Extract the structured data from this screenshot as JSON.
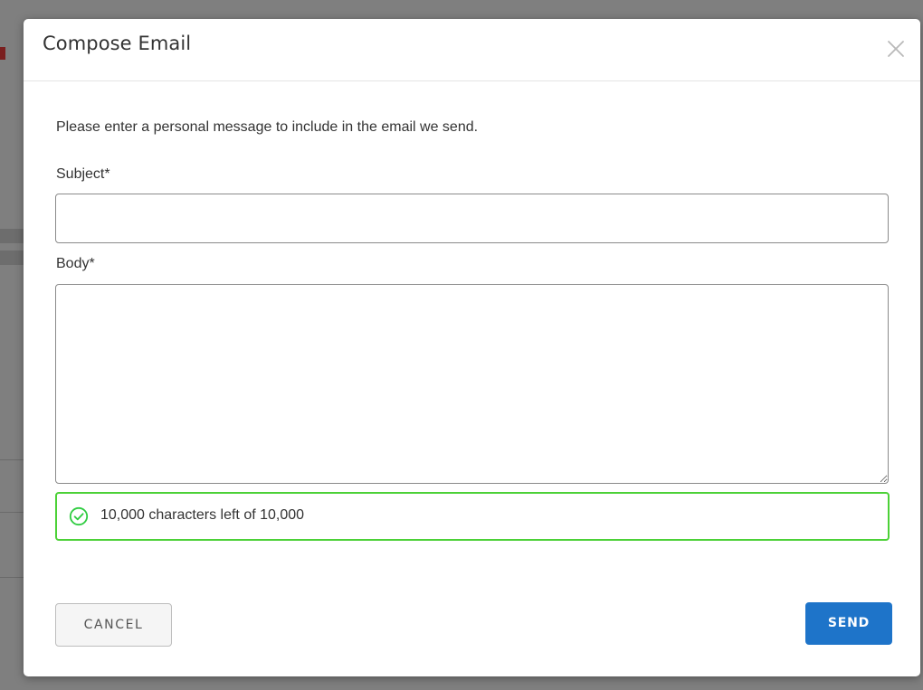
{
  "dialog": {
    "title": "Compose Email",
    "close_icon": "close-icon"
  },
  "intro_text": "Please enter a personal message to include in the email we send.",
  "subject": {
    "label": "Subject*",
    "value": "",
    "placeholder": ""
  },
  "body": {
    "label": "Body*",
    "value": "",
    "placeholder": ""
  },
  "char_counter": {
    "icon": "check-circle-icon",
    "text": "10,000 characters left of 10,000",
    "color": "#4cd137"
  },
  "actions": {
    "cancel_label": "CANCEL",
    "send_label": "SEND",
    "send_color": "#1e74c9"
  }
}
